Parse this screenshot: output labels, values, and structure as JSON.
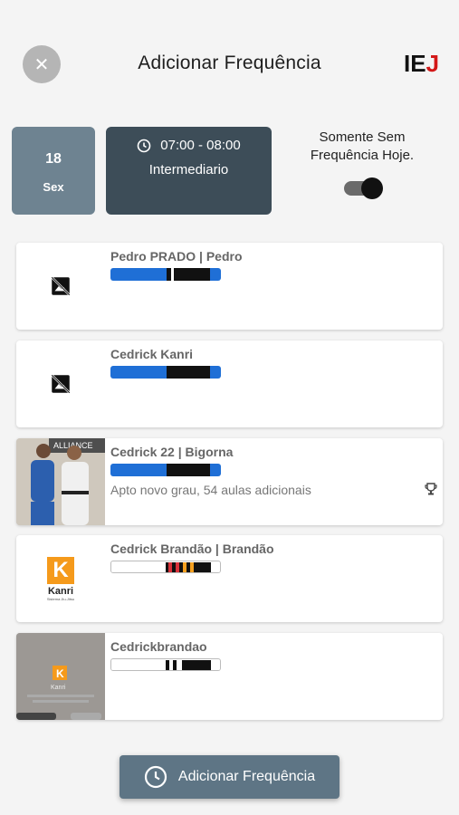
{
  "header": {
    "title": "Adicionar Frequência",
    "close_icon": "close-icon",
    "logo_text_a": "IE",
    "logo_text_b": "J"
  },
  "session": {
    "day": "18",
    "weekday": "Sex",
    "time": "07:00 - 08:00",
    "level": "Intermediario",
    "toggle_label_line1": "Somente Sem",
    "toggle_label_line2": "Frequência Hoje.",
    "toggle_on": true
  },
  "students": [
    {
      "name": "Pedro PRADO | Pedro",
      "status": "",
      "thumb": "no-image-icon",
      "belt": "blue"
    },
    {
      "name": "Cedrick Kanri",
      "status": "",
      "thumb": "no-image-icon",
      "belt": "blue"
    },
    {
      "name": "Cedrick 22 | Bigorna",
      "status": "Apto novo grau, 54 aulas adicionais",
      "thumb": "photo",
      "photo_text": "ALLIANCE",
      "belt": "blue",
      "trophy": true
    },
    {
      "name": "Cedrick Brandão | Brandão",
      "status": "",
      "thumb": "logo",
      "logo_letter": "K",
      "logo_name": "Kanri",
      "logo_sub": "Sistema Jiu-Jitsu",
      "belt": "white-coral"
    },
    {
      "name": "Cedrickbrandao",
      "status": "",
      "thumb": "screenshot",
      "logo_letter": "K",
      "logo_name": "Kanri",
      "belt": "white"
    }
  ],
  "colors": {
    "accent": "#5e7585",
    "date_box": "#6e8391",
    "class_box": "#3d4d58",
    "belt_blue": "#1f6fd6",
    "belt_black": "#111111"
  },
  "fab": {
    "label": "Adicionar Frequência",
    "icon": "clock-icon"
  }
}
